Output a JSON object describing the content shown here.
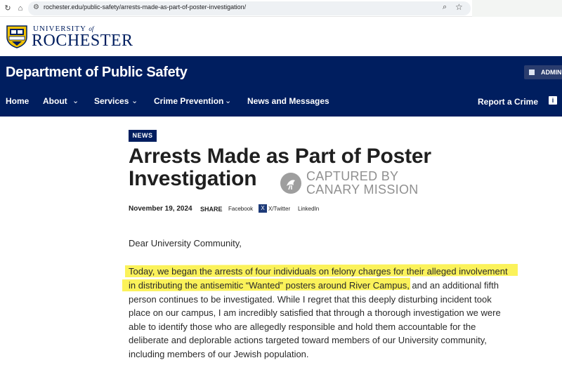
{
  "browser": {
    "url": "rochester.edu/public-safety/arrests-made-as-part-of-poster-investigation/"
  },
  "university": {
    "name_top": "UNIVERSITY",
    "name_of": "of",
    "name_main": "ROCHESTER"
  },
  "department": {
    "title": "Department of Public Safety",
    "admin_label": "ADMINI"
  },
  "nav": {
    "items": [
      {
        "label": "Home"
      },
      {
        "label": "About"
      },
      {
        "label": "Services"
      },
      {
        "label": "Crime Prevention"
      },
      {
        "label": "News and Messages"
      }
    ],
    "report_label": "Report a Crime"
  },
  "article": {
    "badge": "NEWS",
    "title_line1": "Arrests Made as Part of Poster",
    "title_line2": "Investigation",
    "watermark_line1": "CAPTURED BY",
    "watermark_line2": "CANARY MISSION",
    "date": "November 19, 2024",
    "share_label": "SHARE",
    "share_links": [
      "Facebook",
      "X/Twitter",
      "LinkedIn"
    ],
    "greeting": "Dear University Community,",
    "lines": [
      "Today, we began the arrests of four individuals on felony charges for their alleged involvement",
      "in distributing the antisemitic “Wanted” posters around River Campus, and an additional fifth",
      "person continues to be investigated. While I regret that this deeply disturbing incident took",
      "place on our campus, I am incredibly satisfied that through a thorough investigation we were",
      "able to identify those who are allegedly responsible and hold them accountable for the",
      "deliberate and deplorable actions targeted toward members of our University community,",
      "including members of our Jewish population."
    ]
  },
  "colors": {
    "brand_navy": "#001e5f",
    "highlight": "#fbf25a"
  },
  "icons": [
    "back-icon",
    "home-icon",
    "tune-icon",
    "zoom-icon",
    "star-icon",
    "crest-icon",
    "admin-icon",
    "chevron-down-icon",
    "info-icon",
    "x-twitter-icon",
    "canary-mission-logo-icon"
  ]
}
